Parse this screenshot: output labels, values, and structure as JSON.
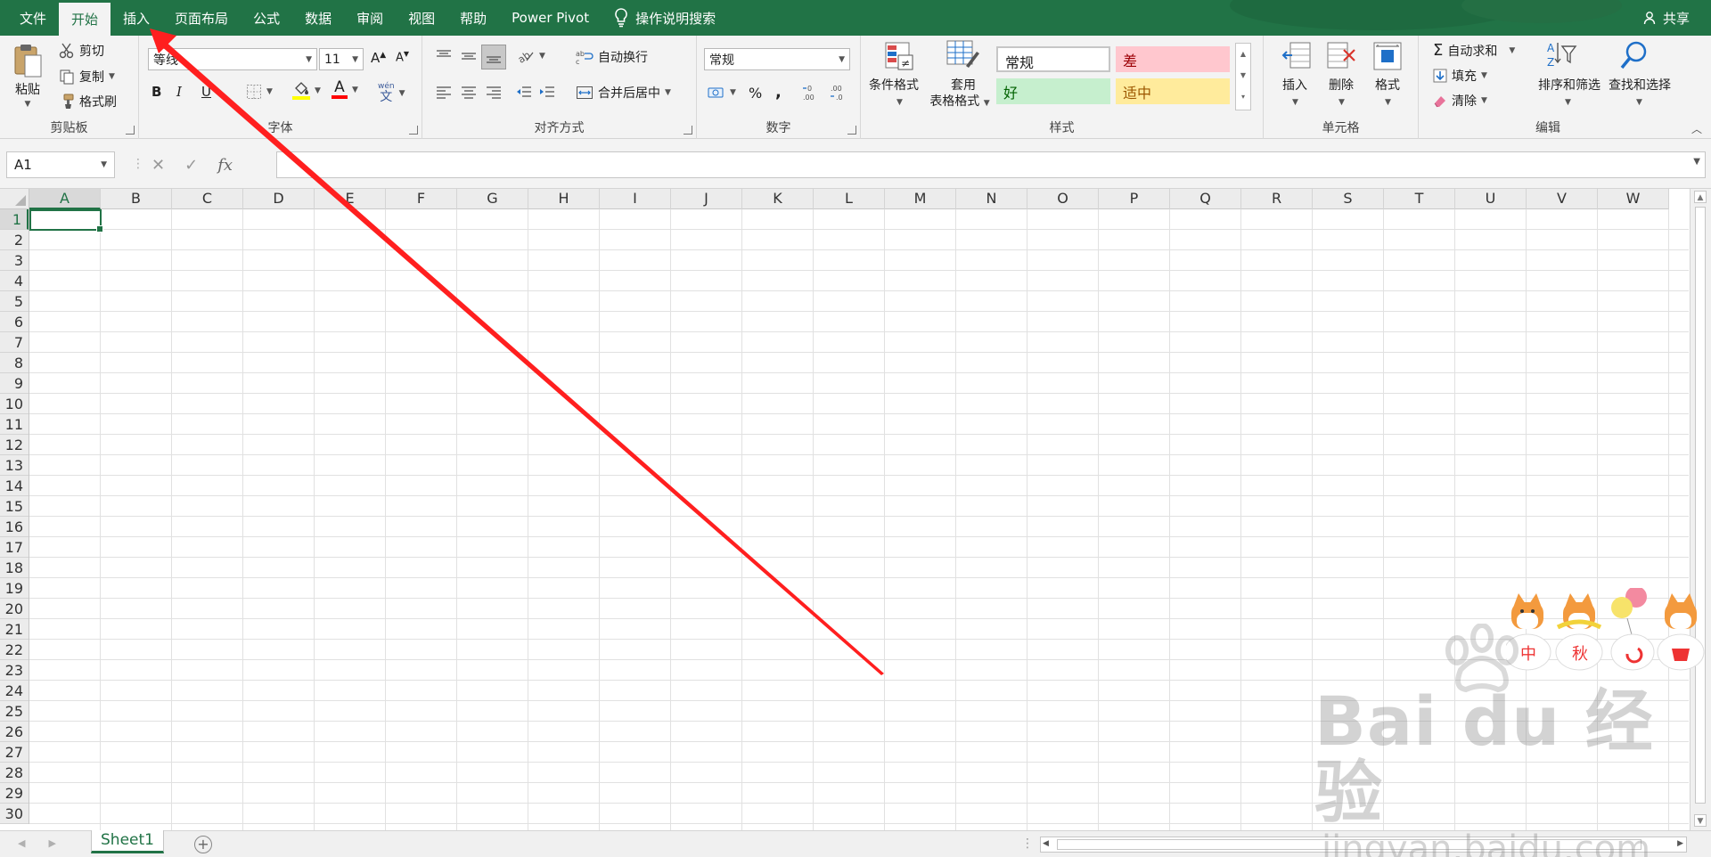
{
  "tabs": [
    {
      "label": "文件",
      "active": false
    },
    {
      "label": "开始",
      "active": true
    },
    {
      "label": "插入",
      "active": false
    },
    {
      "label": "页面布局",
      "active": false
    },
    {
      "label": "公式",
      "active": false
    },
    {
      "label": "数据",
      "active": false
    },
    {
      "label": "审阅",
      "active": false
    },
    {
      "label": "视图",
      "active": false
    },
    {
      "label": "帮助",
      "active": false
    },
    {
      "label": "Power Pivot",
      "active": false
    }
  ],
  "tell_me": "操作说明搜索",
  "share": "共享",
  "ribbon": {
    "clipboard": {
      "paste": "粘贴",
      "cut": "剪切",
      "copy": "复制",
      "format_painter": "格式刷",
      "label": "剪贴板"
    },
    "font": {
      "font_name": "等线",
      "font_size": "11",
      "label": "字体",
      "bold": "B",
      "italic": "I",
      "underline": "U"
    },
    "alignment": {
      "wrap_text": "自动换行",
      "merge_center": "合并后居中",
      "label": "对齐方式"
    },
    "number": {
      "format": "常规",
      "percent": "%",
      "comma": ",",
      "label": "数字"
    },
    "styles": {
      "conditional_formatting": "条件格式",
      "format_as_table_line1": "套用",
      "format_as_table_line2": "表格格式",
      "normal": "常规",
      "bad": "差",
      "good": "好",
      "neutral": "适中",
      "label": "样式"
    },
    "cells": {
      "insert": "插入",
      "delete": "删除",
      "format": "格式",
      "label": "单元格"
    },
    "editing": {
      "autosum": "自动求和",
      "fill": "填充",
      "clear": "清除",
      "sort_filter": "排序和筛选",
      "find_select": "查找和选择",
      "label": "编辑"
    }
  },
  "formula_bar": {
    "name_box": "A1",
    "fx": "fx",
    "formula": ""
  },
  "columns": [
    "A",
    "B",
    "C",
    "D",
    "E",
    "F",
    "G",
    "H",
    "I",
    "J",
    "K",
    "L",
    "M",
    "N",
    "O",
    "P",
    "Q",
    "R",
    "S",
    "T",
    "U",
    "V",
    "W"
  ],
  "rows": [
    "1",
    "2",
    "3",
    "4",
    "5",
    "6",
    "7",
    "8",
    "9",
    "10",
    "11",
    "12",
    "13",
    "14",
    "15",
    "16",
    "17",
    "18",
    "19",
    "20",
    "21",
    "22",
    "23",
    "24",
    "25",
    "26",
    "27",
    "28",
    "29",
    "30"
  ],
  "selected_cell": "A1",
  "sheets": [
    {
      "name": "Sheet1",
      "active": true
    }
  ],
  "annotation": {
    "color": "#ff1f1f",
    "points_to": "插入"
  },
  "stickers": [
    "中",
    "秋",
    "",
    ""
  ],
  "watermark": {
    "logo": "Bai  du 经验",
    "url": "jingyan.baidu.com"
  },
  "colors": {
    "accent": "#217346",
    "bad_bg": "#ffc7ce",
    "bad_fg": "#9c0006",
    "good_bg": "#c6efce",
    "good_fg": "#006100",
    "neutral_bg": "#ffeb9c",
    "neutral_fg": "#9c5700"
  }
}
